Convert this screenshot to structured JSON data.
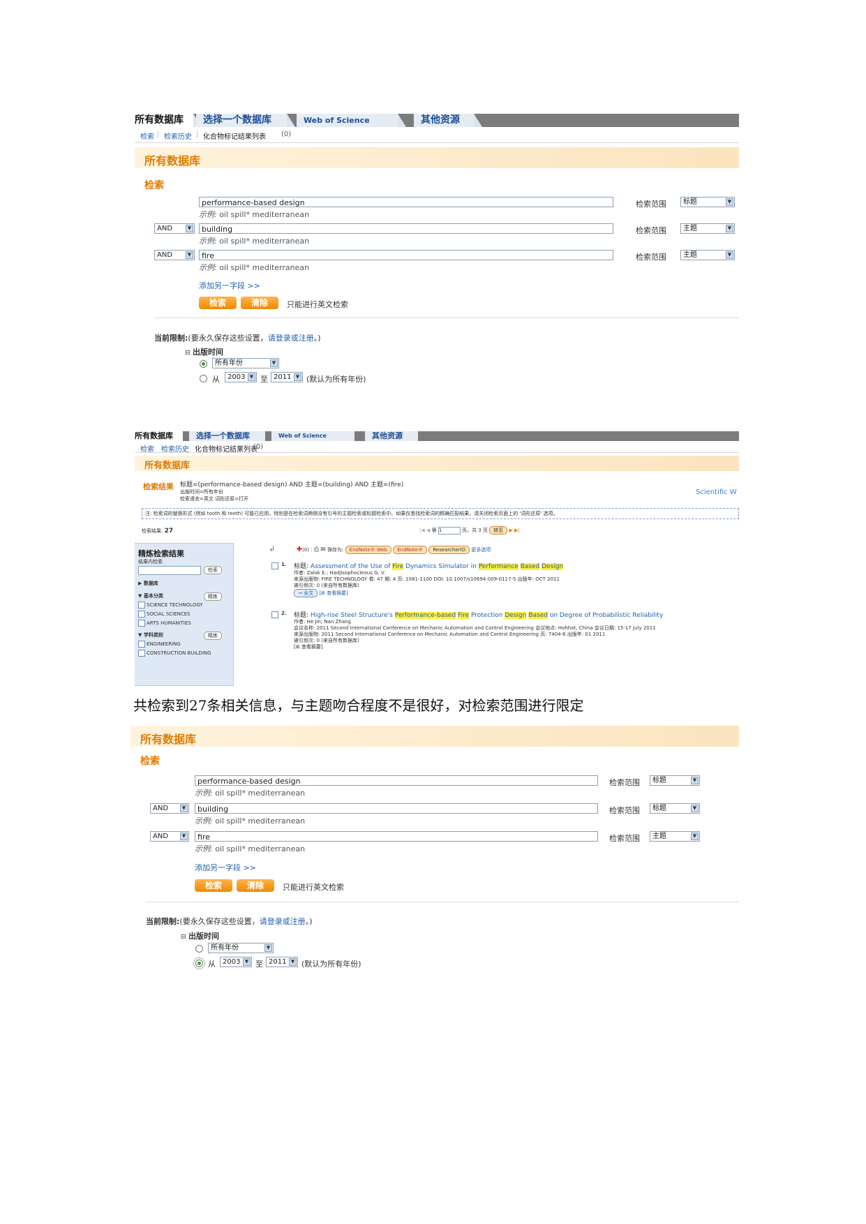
{
  "tabs": {
    "all_db": "所有数据库",
    "select_db": "选择一个数据库",
    "wos": "Web of Science",
    "other": "其他资源"
  },
  "subnav": {
    "search": "检索",
    "history": "检索历史",
    "compound": "化合物标记结果列表",
    "compound_count": "(0)"
  },
  "section_title": "所有数据库",
  "search_heading": "检索",
  "example_prefix": "示例:",
  "example_text": "oil spill* mediterranean",
  "scope_label": "检索范围",
  "add_field": "添加另一字段  >>",
  "search_btn": "检索",
  "clear_btn": "清除",
  "english_only": "只能进行英文检索",
  "limits": {
    "label": "当前限制:",
    "note": "(要永久保存这些设置，",
    "login_link": "请登录或注册",
    "note_end": "。)",
    "pub_time": "出版时间",
    "all_years": "所有年份",
    "from": "从",
    "to": "至",
    "year_from": "2003",
    "year_to": "2011",
    "default_note": "(默认为所有年份)"
  },
  "form1": {
    "rows": [
      {
        "op": "",
        "value": "performance-based design",
        "scope": "标题"
      },
      {
        "op": "AND",
        "value": "building",
        "scope": "主题"
      },
      {
        "op": "AND",
        "value": "fire",
        "scope": "主题"
      }
    ]
  },
  "form2": {
    "rows": [
      {
        "op": "",
        "value": "performance-based design",
        "scope": "标题"
      },
      {
        "op": "AND",
        "value": "building",
        "scope": "标题"
      },
      {
        "op": "AND",
        "value": "fire",
        "scope": "主题"
      }
    ]
  },
  "results": {
    "heading": "检索结果",
    "query": "标题=(performance-based design) AND 主题=(building) AND 主题=(fire)",
    "time_line": "出版时间=所有年份",
    "lang_line": "检索语言=英文  词形还原=打开",
    "brand": "Scientific W",
    "note": "注: 检索词的替换形式 (例如 tooth 和 teeth) 可能已应用，特别是在检索词两侧没有引号的主题检索或标题检索中。如果仅查找检索词的精确匹配结果，请关闭检索页面上的 '词形还原' 选项。",
    "count_label": "检索结果:",
    "count": "27",
    "page_prefix": "第",
    "page_value": "1",
    "page_suffix": "页，共 3 页",
    "go_btn": "转至",
    "marked": "(0)",
    "save_to": "保存为:",
    "endnote_web": "EndNote® Web",
    "endnote": "EndNote®",
    "researcher_id": "ResearcherID",
    "more": "更多选项",
    "refine": {
      "title": "精炼检索结果",
      "within": "结果内检索",
      "search_btn": "检索",
      "databases": "数据库",
      "basic": "基本分类",
      "refine_btn": "精炼",
      "basic_items": [
        "SCIENCE TECHNOLOGY",
        "SOCIAL SCIENCES",
        "ARTS HUMANITIES"
      ],
      "subject": "学科类别",
      "subject_items": [
        "ENGINEERING",
        "CONSTRUCTION BUILDING"
      ]
    },
    "records": [
      {
        "num": "1.",
        "title_prefix": "标题:",
        "title_parts": [
          {
            "t": "Assessment of the Use of "
          },
          {
            "t": "Fire",
            "hl": true
          },
          {
            "t": " Dynamics Simulator in "
          },
          {
            "t": "Performance",
            "hl": true
          },
          {
            "t": " "
          },
          {
            "t": "Based",
            "hl": true
          },
          {
            "t": " "
          },
          {
            "t": "Design",
            "hl": true
          }
        ],
        "authors": "作者: Zalok E.; Hadjisophocleous G. V.",
        "source": "来源出版物: FIRE TECHNOLOGY  卷: 47  期: 4  页: 1081-1100  DOI: 10.1007/s10694-009-0117-5  出版年: OCT 2011",
        "cited": "被引频次: 0 (来自所有数据库)",
        "fulltext": "→ 全文",
        "abstract": "[⊞ 查看摘要]"
      },
      {
        "num": "2.",
        "title_prefix": "标题:",
        "title_parts": [
          {
            "t": "High-rise Steel Structure's "
          },
          {
            "t": "Performance-based",
            "hl": true
          },
          {
            "t": " "
          },
          {
            "t": "Fire",
            "hl": true
          },
          {
            "t": " Protection "
          },
          {
            "t": "Design",
            "hl": true
          },
          {
            "t": " "
          },
          {
            "t": "Based",
            "hl": true
          },
          {
            "t": " on Degree of Probabilistic Reliability"
          }
        ],
        "authors": "作者: He Jin; Nan Zhang",
        "conference": "会议名称: 2011 Second International Conference on Mechanic Automation and Control Engineering 会议地点: Hohhot, China 会议日期: 15-17 July 2011",
        "source": "来源出版物: 2011 Second International Conference on Mechanic Automation and Control Engineering  页: 7404-6  出版年: 01 2011",
        "cited": "被引频次: 0 (来自所有数据库)",
        "abstract": "[⊞ 查看摘要]"
      }
    ]
  },
  "caption": "共检索到27条相关信息，与主题吻合程度不是很好，对检索范围进行限定"
}
